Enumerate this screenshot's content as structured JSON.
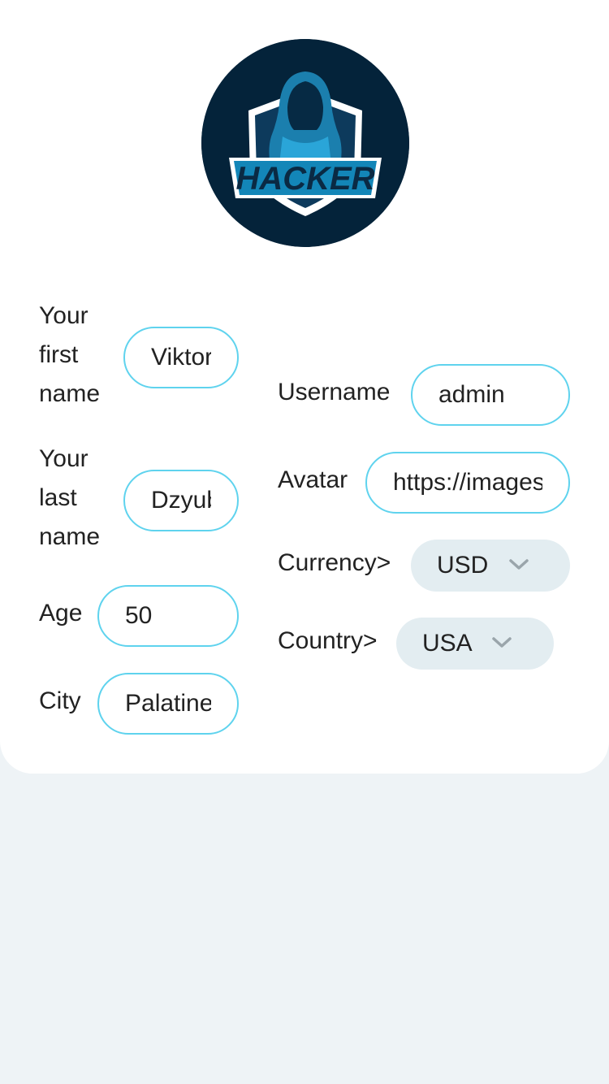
{
  "avatar": {
    "logo_text": "HACKER",
    "colors": {
      "background": "#04233a",
      "accent": "#1e9fd0"
    }
  },
  "left": {
    "first_name": {
      "label_lines": [
        "Your",
        "first",
        "name"
      ],
      "value": "Viktor"
    },
    "last_name": {
      "label_lines": [
        "Your",
        "last",
        "name"
      ],
      "value": "Dzyuba"
    },
    "age": {
      "label": "Age",
      "value": "50"
    },
    "city": {
      "label": "City",
      "value": "Palatine"
    }
  },
  "right": {
    "username": {
      "label": "Username",
      "value": "admin"
    },
    "avatar_url": {
      "label": "Avatar",
      "value": "https://images"
    },
    "currency": {
      "label": "Currency>",
      "selected": "USD"
    },
    "country": {
      "label": "Country>",
      "selected": "USA"
    }
  },
  "colors": {
    "field_border": "#5fd3ee",
    "select_bg": "#e3edf1",
    "page_bg": "#eef3f6"
  }
}
